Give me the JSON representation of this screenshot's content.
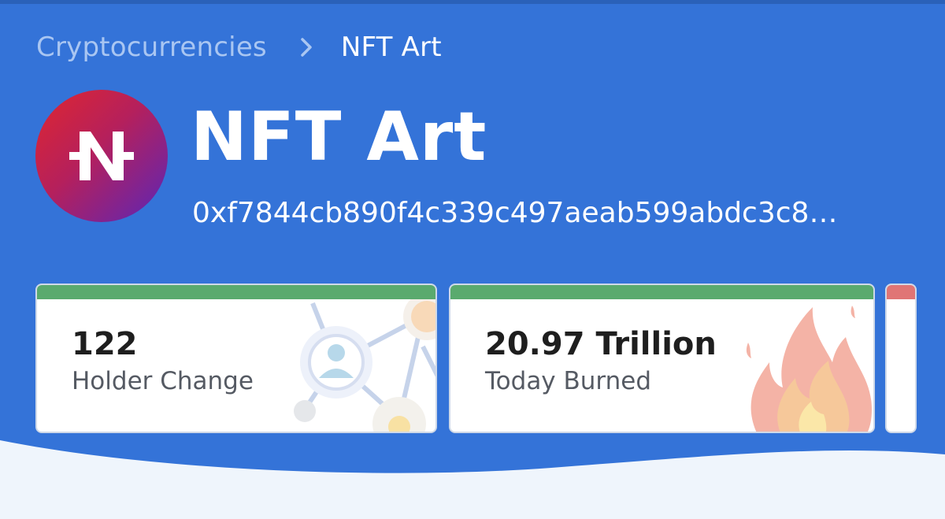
{
  "breadcrumb": {
    "parent": "Cryptocurrencies",
    "current": "NFT Art"
  },
  "token": {
    "logo_letter": "N",
    "name": "NFT Art",
    "address": "0xf7844cb890f4c339c497aeab599abdc3c8…"
  },
  "cards": [
    {
      "value": "122",
      "label": "Holder Change",
      "accent": "#5aaa6e",
      "icon": "network-people-icon"
    },
    {
      "value": "20.97 Trillion",
      "label": "Today Burned",
      "accent": "#5aaa6e",
      "icon": "fire-icon"
    },
    {
      "value": "",
      "label": "",
      "accent": "#e07575",
      "icon": ""
    }
  ],
  "colors": {
    "background": "#3473d8",
    "wave": "#eff5fc"
  }
}
